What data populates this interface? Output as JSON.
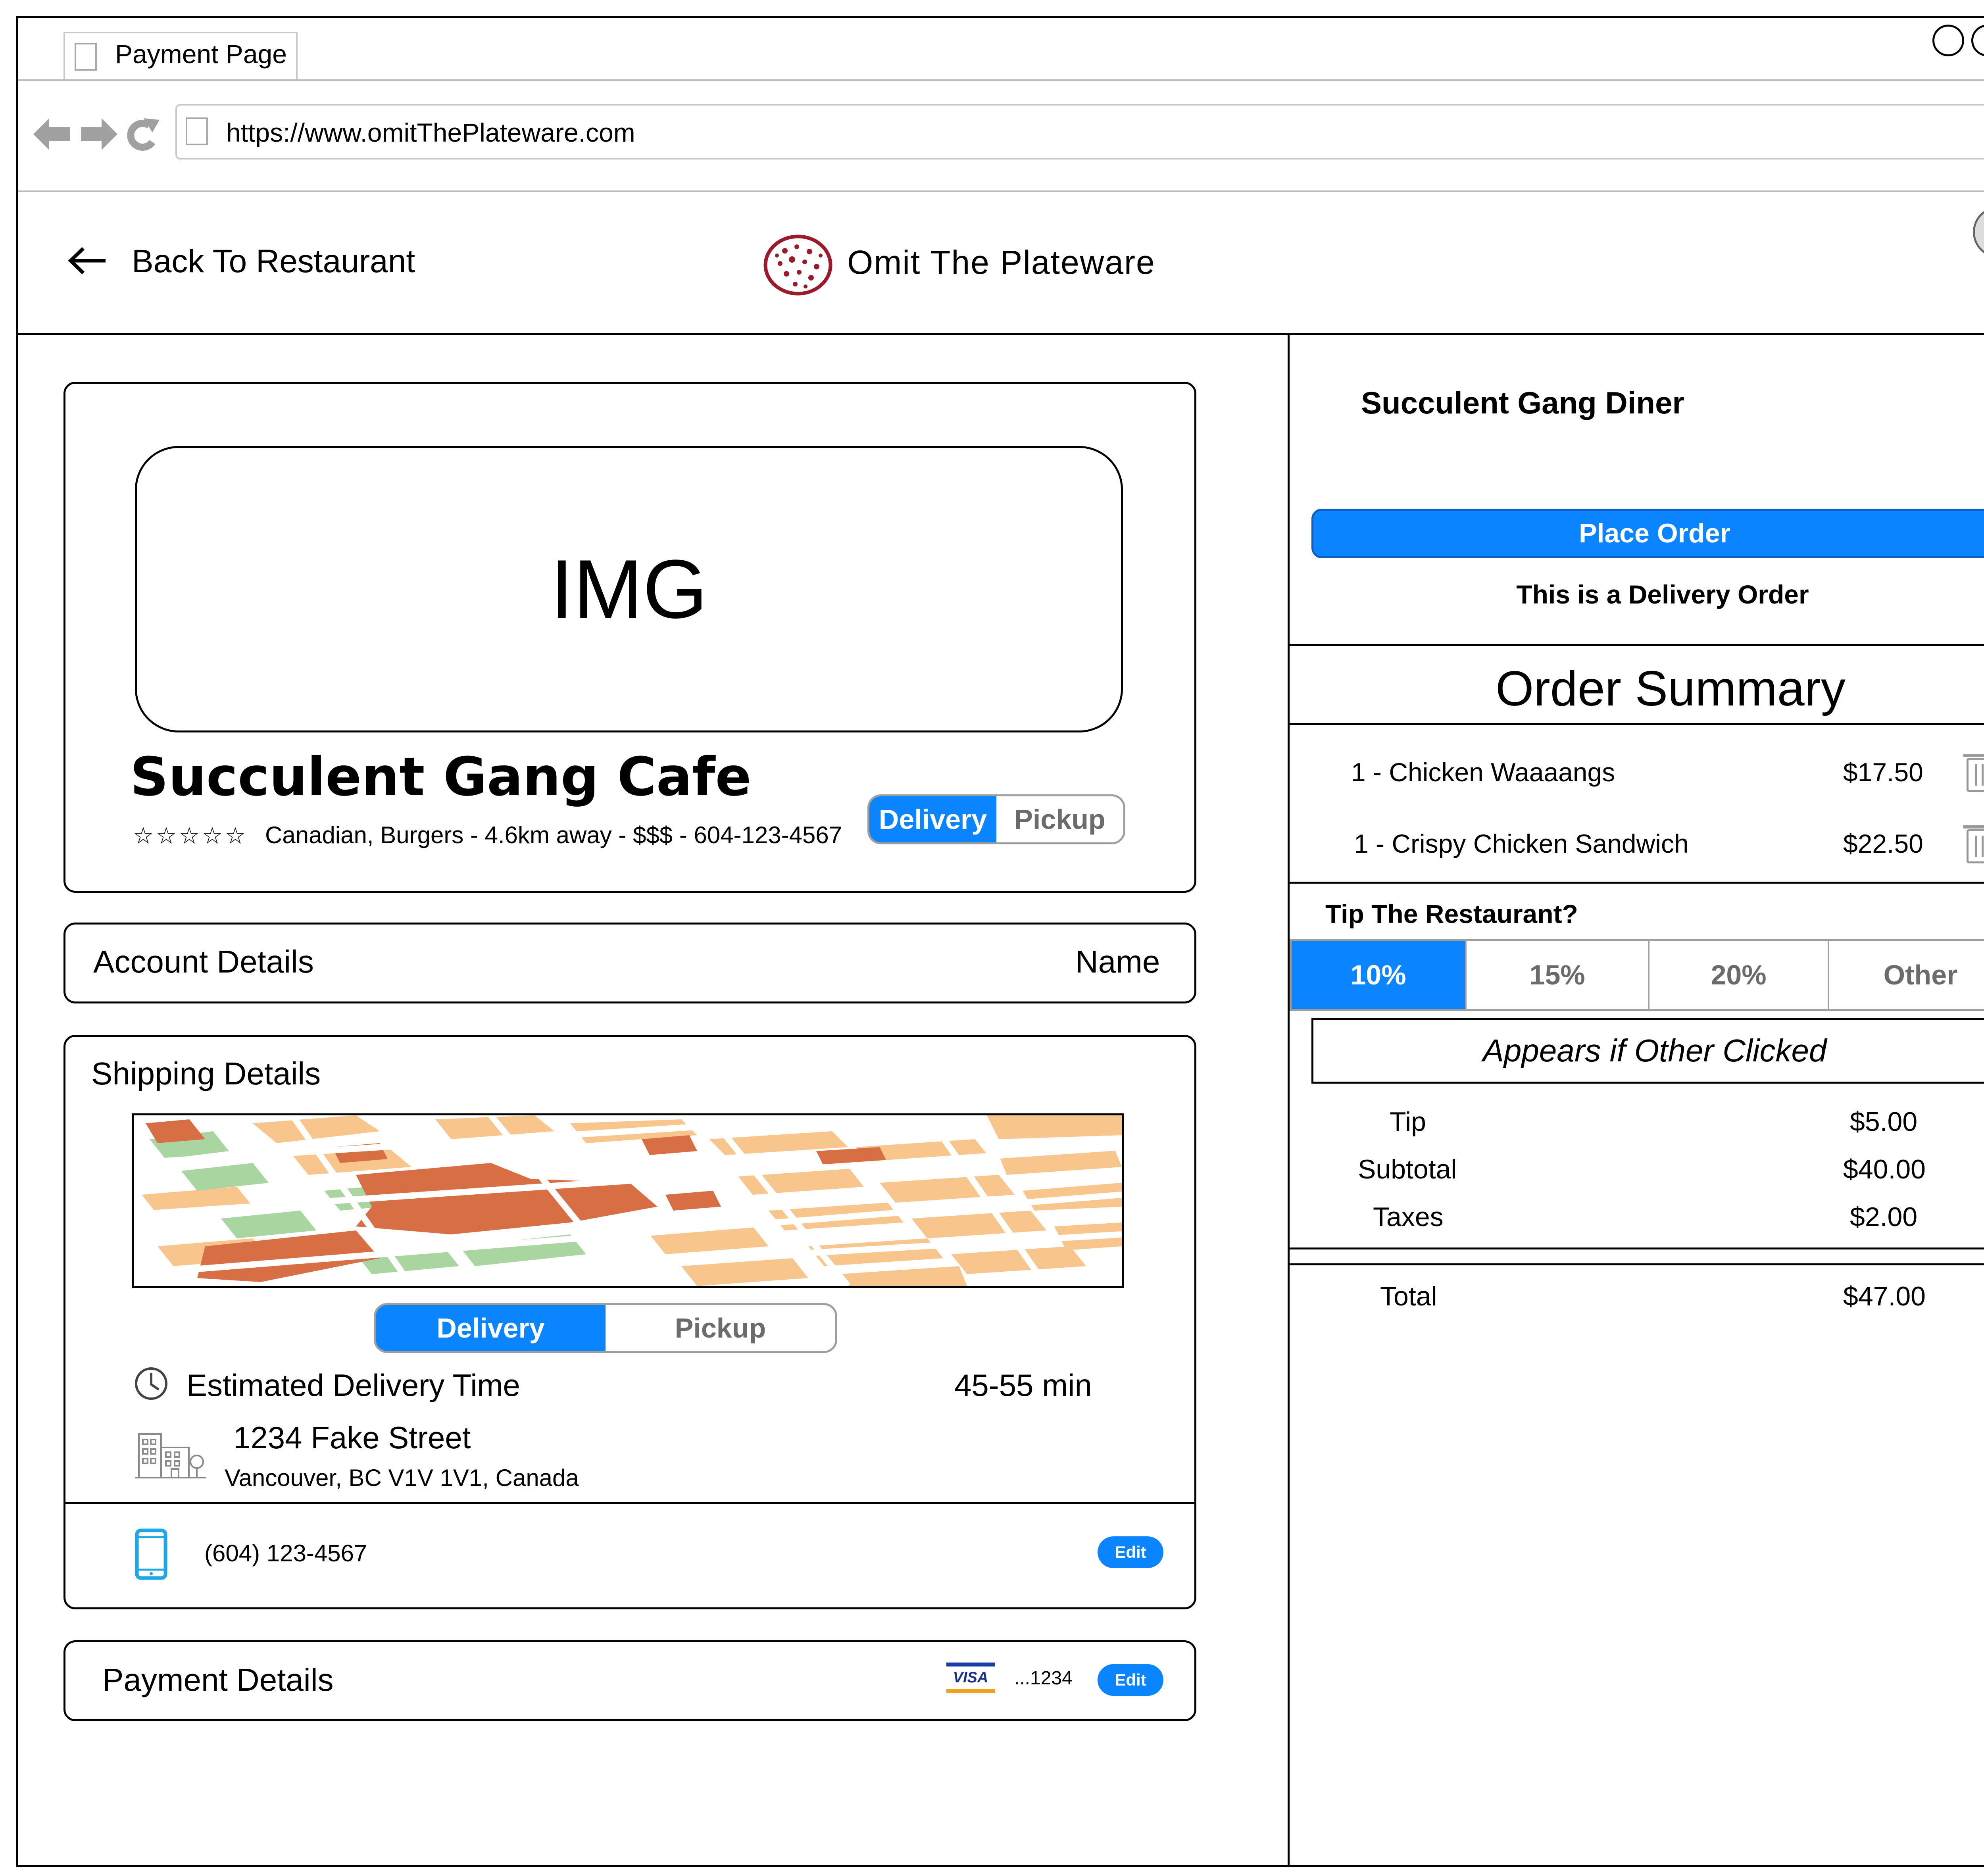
{
  "browser": {
    "tab_title": "Payment Page",
    "url": "https://www.omitThePlateware.com"
  },
  "header": {
    "back_label": "Back To Restaurant",
    "brand_name": "Omit The Plateware",
    "help_label": "?"
  },
  "restaurant_card": {
    "image_placeholder": "IMG",
    "name": "Succulent Gang Cafe",
    "rating_stars": "☆☆☆☆☆",
    "meta": "Canadian, Burgers - 4.6km away - $$$ - 604-123-4567",
    "mode_options": [
      "Delivery",
      "Pickup"
    ],
    "selected_mode": "Delivery"
  },
  "account": {
    "label": "Account Details",
    "value": "Name"
  },
  "shipping": {
    "label": "Shipping Details",
    "mode_options": [
      "Delivery",
      "Pickup"
    ],
    "selected_mode": "Delivery",
    "eta_label": "Estimated Delivery Time",
    "eta_value": "45-55 min",
    "street": "1234 Fake Street",
    "city_line": "Vancouver, BC V1V 1V1, Canada",
    "phone": "(604) 123-4567",
    "edit_label": "Edit"
  },
  "payment": {
    "label": "Payment Details",
    "card_brand": "VISA",
    "card_last4": "...1234",
    "edit_label": "Edit"
  },
  "order_panel": {
    "restaurant_name": "Succulent Gang Diner",
    "place_order_label": "Place Order",
    "order_type_note": "This is a Delivery Order",
    "summary_title": "Order Summary",
    "items": [
      {
        "name": "1 - Chicken Waaaangs",
        "price": "$17.50"
      },
      {
        "name": "1 - Crispy Chicken Sandwich",
        "price": "$22.50"
      }
    ],
    "tip_question": "Tip The Restaurant?",
    "tip_options": [
      "10%",
      "15%",
      "20%",
      "Other"
    ],
    "selected_tip": "10%",
    "other_placeholder": "Appears if Other Clicked",
    "totals": {
      "tip_label": "Tip",
      "tip_value": "$5.00",
      "subtotal_label": "Subtotal",
      "subtotal_value": "$40.00",
      "taxes_label": "Taxes",
      "taxes_value": "$2.00",
      "total_label": "Total",
      "total_value": "$47.00"
    }
  },
  "colors": {
    "accent": "#0a84ff",
    "brand_logo": "#9b1b2a",
    "scrollbar": "#a4dcff"
  },
  "icons": [
    "page-icon",
    "back-arrow-icon",
    "forward-arrow-icon",
    "reload-icon",
    "left-arrow-icon",
    "brand-logo-icon",
    "help-icon",
    "clock-icon",
    "building-icon",
    "phone-icon",
    "visa-icon",
    "trash-icon",
    "scroll-up-icon",
    "scroll-down-icon"
  ]
}
